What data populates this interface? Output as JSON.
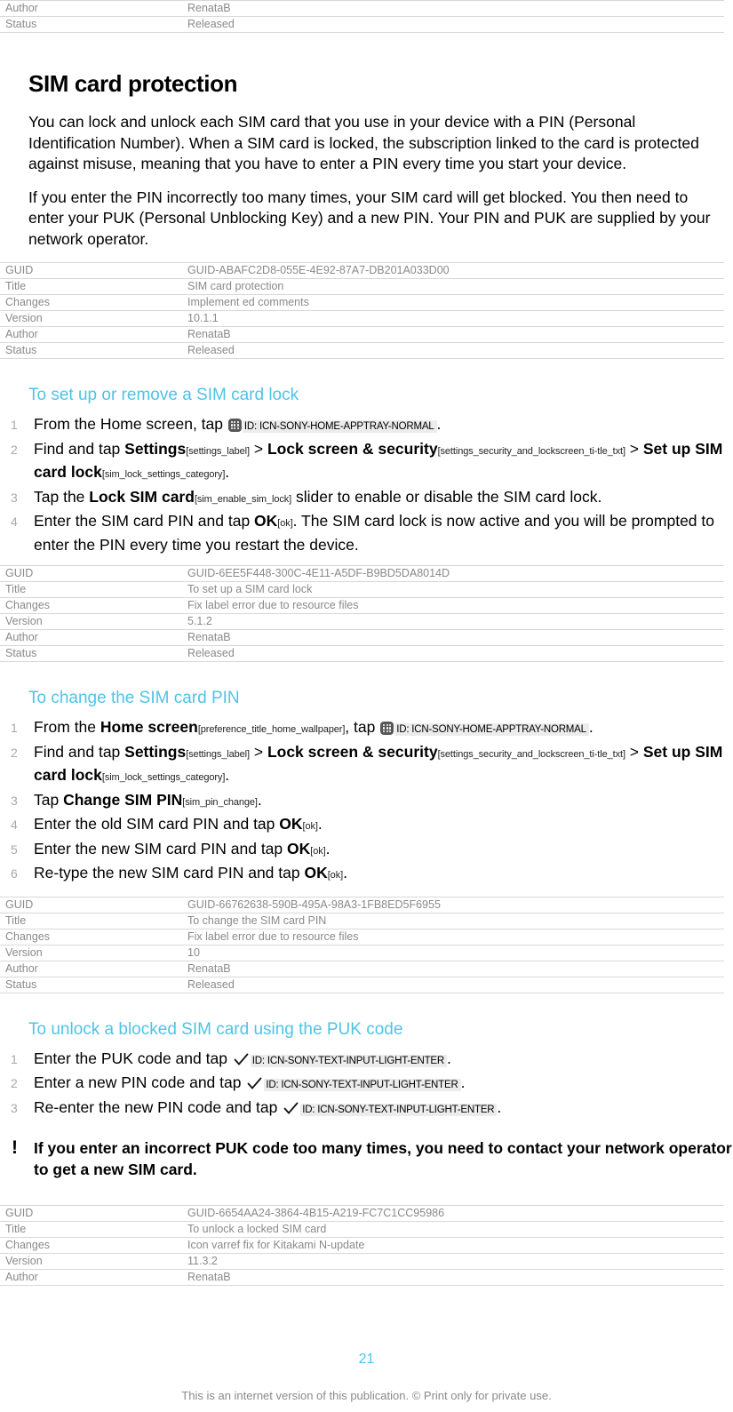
{
  "colors": {
    "heading_accent": "#4fc3e8",
    "meta_text": "#8a8a8a",
    "meta_border": "#d8d8d8",
    "icon_ref_bg": "#ececec",
    "step_number": "#a8a8a8",
    "body_text": "#000000"
  },
  "meta_headers": {
    "guid": "GUID",
    "title": "Title",
    "changes": "Changes",
    "version": "Version",
    "author": "Author",
    "status": "Status"
  },
  "top_table": {
    "rows": [
      {
        "key": "Author",
        "value": "RenataB"
      },
      {
        "key": "Status",
        "value": "Released"
      }
    ]
  },
  "article": {
    "title": "SIM card protection",
    "paragraphs": [
      "You can lock and unlock each SIM card that you use in your device with a PIN (Personal Identification Number). When a SIM card is locked, the subscription linked to the card is protected against misuse, meaning that you have to enter a PIN every time you start your device.",
      "If you enter the PIN incorrectly too many times, your SIM card will get blocked. You then need to enter your PUK (Personal Unblocking Key) and a new PIN. Your PIN and PUK are supplied by your network operator."
    ]
  },
  "table_1": {
    "rows": [
      {
        "key": "GUID",
        "value": "GUID-ABAFC2D8-055E-4E92-87A7-DB201A033D00"
      },
      {
        "key": "Title",
        "value": "SIM card protection"
      },
      {
        "key": "Changes",
        "value": "Implement ed comments"
      },
      {
        "key": "Version",
        "value": "10.1.1"
      },
      {
        "key": "Author",
        "value": "RenataB"
      },
      {
        "key": "Status",
        "value": "Released"
      }
    ]
  },
  "section_1": {
    "heading": "To set up or remove a SIM card lock",
    "steps": {
      "s1": {
        "pre": "From the Home screen, tap ",
        "icon_label": "ID: ICN-SONY-HOME-APPTRAY-NORMAL",
        "post": "."
      },
      "s2": {
        "a": "Find and tap ",
        "b1": "Settings",
        "v1": "[settings_label]",
        "sep1": " > ",
        "b2": "Lock screen & security",
        "v2": "[settings_security_and_lockscreen_ti-tle_txt]",
        "sep2": " > ",
        "b3": "Set up SIM card lock",
        "v3": "[sim_lock_settings_category]",
        "post": "."
      },
      "s3": {
        "a": "Tap the ",
        "b1": "Lock SIM card",
        "v1": "[sim_enable_sim_lock]",
        "post": " slider to enable or disable the SIM card lock."
      },
      "s4": {
        "a": "Enter the SIM card PIN and tap ",
        "b1": "OK",
        "v1": "[ok]",
        "post": ". The SIM card lock is now active and you will be prompted to enter the PIN every time you restart the device."
      }
    }
  },
  "table_2": {
    "rows": [
      {
        "key": "GUID",
        "value": "GUID-6EE5F448-300C-4E11-A5DF-B9BD5DA8014D"
      },
      {
        "key": "Title",
        "value": "To set up a SIM card lock"
      },
      {
        "key": "Changes",
        "value": "Fix label error due to resource files"
      },
      {
        "key": "Version",
        "value": "5.1.2"
      },
      {
        "key": "Author",
        "value": "RenataB"
      },
      {
        "key": "Status",
        "value": "Released"
      }
    ]
  },
  "section_2": {
    "heading": "To change the SIM card PIN",
    "steps": {
      "s1": {
        "a": "From the ",
        "b1": "Home screen",
        "v1": "[preference_title_home_wallpaper]",
        "mid": ", tap ",
        "icon_label": "ID: ICN-SONY-HOME-APPTRAY-NORMAL",
        "post": "."
      },
      "s2": {
        "a": "Find and tap ",
        "b1": "Settings",
        "v1": "[settings_label]",
        "sep1": " > ",
        "b2": "Lock screen & security",
        "v2": "[settings_security_and_lockscreen_ti-tle_txt]",
        "sep2": " > ",
        "b3": "Set up SIM card lock",
        "v3": "[sim_lock_settings_category]",
        "post": "."
      },
      "s3": {
        "a": "Tap ",
        "b1": "Change SIM PIN",
        "v1": "[sim_pin_change]",
        "post": "."
      },
      "s4": {
        "a": "Enter the old SIM card PIN and tap ",
        "b1": "OK",
        "v1": "[ok]",
        "post": "."
      },
      "s5": {
        "a": "Enter the new SIM card PIN and tap ",
        "b1": "OK",
        "v1": "[ok]",
        "post": "."
      },
      "s6": {
        "a": "Re-type the new SIM card PIN and tap ",
        "b1": "OK",
        "v1": "[ok]",
        "post": "."
      }
    }
  },
  "table_3": {
    "rows": [
      {
        "key": "GUID",
        "value": "GUID-66762638-590B-495A-98A3-1FB8ED5F6955"
      },
      {
        "key": "Title",
        "value": "To change the SIM card PIN"
      },
      {
        "key": "Changes",
        "value": "Fix label error due to resource files"
      },
      {
        "key": "Version",
        "value": "10"
      },
      {
        "key": "Author",
        "value": "RenataB"
      },
      {
        "key": "Status",
        "value": "Released"
      }
    ]
  },
  "section_3": {
    "heading": "To unlock a blocked SIM card using the PUK code",
    "steps": {
      "s1": {
        "a": "Enter the PUK code and tap ",
        "icon_label": "ID: ICN-SONY-TEXT-INPUT-LIGHT-ENTER",
        "post": "."
      },
      "s2": {
        "a": "Enter a new PIN code and tap ",
        "icon_label": "ID: ICN-SONY-TEXT-INPUT-LIGHT-ENTER",
        "post": "."
      },
      "s3": {
        "a": "Re-enter the new PIN code and tap ",
        "icon_label": "ID: ICN-SONY-TEXT-INPUT-LIGHT-ENTER",
        "post": "."
      }
    },
    "note": {
      "marker": "!",
      "text": "If you enter an incorrect PUK code too many times, you need to contact your network operator to get a new SIM card."
    }
  },
  "table_4": {
    "rows": [
      {
        "key": "GUID",
        "value": "GUID-6654AA24-3864-4B15-A219-FC7C1CC95986"
      },
      {
        "key": "Title",
        "value": "To unlock a locked SIM card"
      },
      {
        "key": "Changes",
        "value": "Icon varref fix for Kitakami N-update"
      },
      {
        "key": "Version",
        "value": "11.3.2"
      },
      {
        "key": "Author",
        "value": "RenataB"
      }
    ]
  },
  "footer": {
    "page_number": "21",
    "notice": "This is an internet version of this publication. © Print only for private use."
  }
}
